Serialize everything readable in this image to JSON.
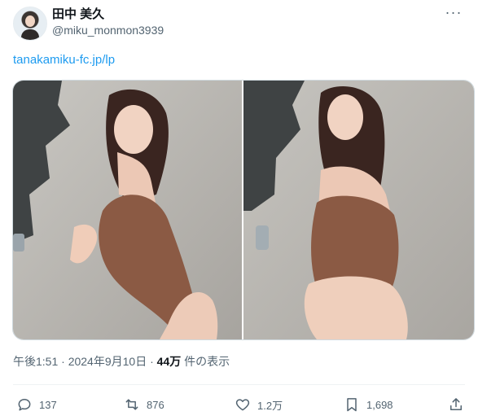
{
  "author": {
    "display_name": "田中 美久",
    "handle": "@miku_monmon3939"
  },
  "tweet": {
    "link_text": "tanakamiku-fc.jp/lp"
  },
  "meta": {
    "time": "午後1:51",
    "separator": " · ",
    "date": "2024年9月10日",
    "views_count": "44万",
    "views_label": " 件の表示"
  },
  "actions": {
    "replies": "137",
    "reposts": "876",
    "likes": "1.2万",
    "bookmarks": "1,698"
  },
  "colors": {
    "link": "#1d9bf0",
    "secondary_text": "#536471",
    "divider": "#eff3f4"
  }
}
